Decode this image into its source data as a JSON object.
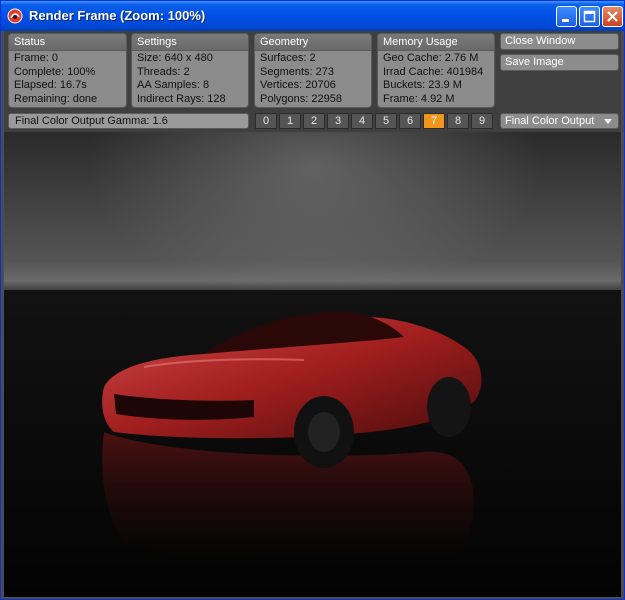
{
  "window": {
    "title": "Render Frame (Zoom: 100%)"
  },
  "panels": {
    "status": {
      "title": "Status",
      "lines": [
        "Frame: 0",
        "Complete: 100%",
        "Elapsed: 16.7s",
        "Remaining: done"
      ]
    },
    "settings": {
      "title": "Settings",
      "lines": [
        "Size: 640 x 480",
        "Threads: 2",
        "AA Samples: 8",
        "Indirect Rays: 128"
      ]
    },
    "geometry": {
      "title": "Geometry",
      "lines": [
        "Surfaces: 2",
        "Segments: 273",
        "Vertices: 20706",
        "Polygons: 22958"
      ]
    },
    "memory": {
      "title": "Memory Usage",
      "lines": [
        "Geo Cache: 2.76 M",
        "Irrad Cache: 401984",
        "Buckets: 23.9 M",
        "Frame: 4.92 M"
      ]
    }
  },
  "buttons": {
    "close_window": "Close Window",
    "save_image": "Save Image"
  },
  "gamma_label": "Final Color Output Gamma: 1.6",
  "frames": {
    "labels": [
      "0",
      "1",
      "2",
      "3",
      "4",
      "5",
      "6",
      "7",
      "8",
      "9"
    ],
    "active_index": 7,
    "accent_color": "#f0961e"
  },
  "output_select": {
    "value": "Final Color Output"
  },
  "colors": {
    "titlebar": "#0050e6",
    "panel": "#8c8c8c",
    "car_paint": "#b02424"
  }
}
